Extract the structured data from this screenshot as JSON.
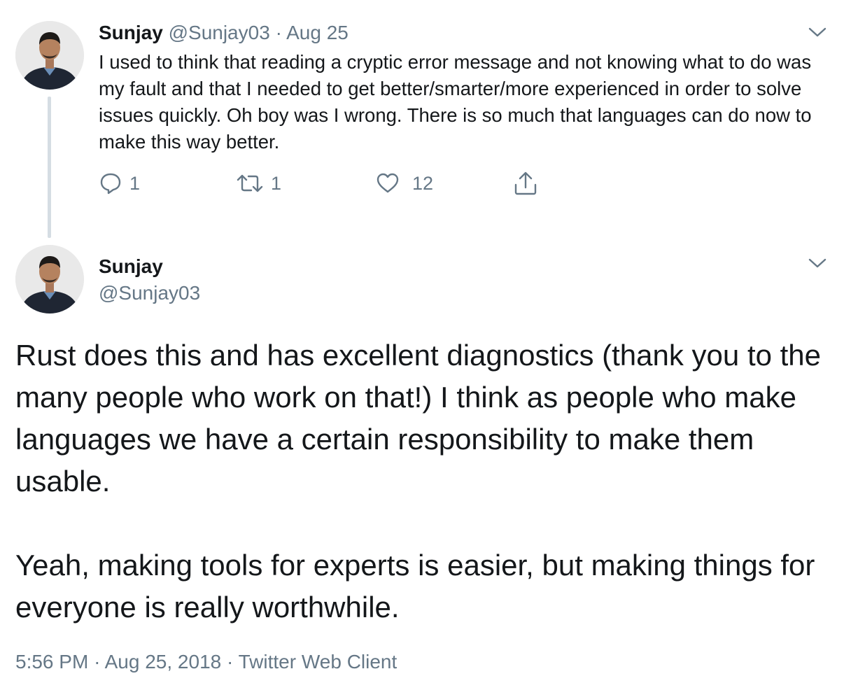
{
  "tweet1": {
    "name": "Sunjay",
    "handle": "@Sunjay03",
    "separator": "·",
    "date": "Aug 25",
    "text": "I used to think that reading a cryptic error message and not knowing what to do was my fault and that I needed to get better/smarter/more experienced in order to solve issues quickly. Oh boy was I wrong. There is so much that languages can do now to make this way better.",
    "actions": {
      "reply_icon": "reply-icon",
      "reply_count": "1",
      "retweet_icon": "retweet-icon",
      "retweet_count": "1",
      "like_icon": "heart-icon",
      "like_count": "12",
      "share_icon": "share-icon"
    },
    "menu_icon": "chevron-down-icon",
    "avatar_icon": "avatar"
  },
  "tweet2": {
    "name": "Sunjay",
    "handle": "@Sunjay03",
    "paragraphs": [
      "Rust does this and has excellent diagnostics (thank you to the many people who work on that!) I think as people who make languages we have a certain responsibility to make them usable.",
      "Yeah, making tools for experts is easier, but making things for everyone is really worthwhile."
    ],
    "time": "5:56 PM",
    "separator": "·",
    "date": "Aug 25, 2018",
    "client": "Twitter Web Client",
    "menu_icon": "chevron-down-icon",
    "avatar_icon": "avatar"
  },
  "colors": {
    "text": "#14171a",
    "muted": "#657786",
    "thread_line": "#d5dde3",
    "background": "#ffffff"
  }
}
